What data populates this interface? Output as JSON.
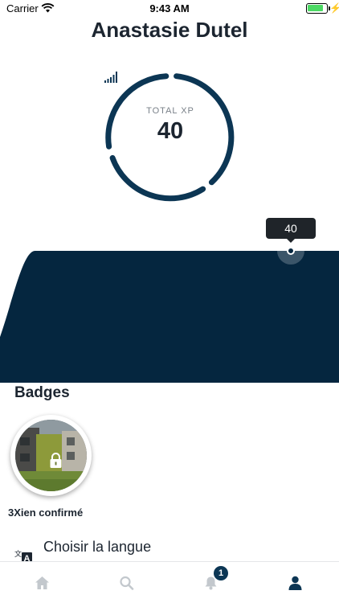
{
  "status_bar": {
    "carrier": "Carrier",
    "time": "9:43 AM",
    "battery_level": 0.85
  },
  "profile": {
    "name": "Anastasie Dutel"
  },
  "xp": {
    "label": "TOTAL XP",
    "value": "40"
  },
  "chart_data": {
    "type": "area",
    "title": "",
    "x": [
      0,
      1,
      2,
      3,
      4,
      5,
      6
    ],
    "values": [
      0,
      40,
      40,
      40,
      40,
      40,
      40
    ],
    "ylim": [
      0,
      40
    ],
    "highlight": {
      "index": 5,
      "label": "40"
    },
    "grid": false,
    "color": "#05263f"
  },
  "badges": {
    "title": "Badges",
    "items": [
      {
        "name": "3Xien confirmé",
        "locked": true
      }
    ]
  },
  "settings": {
    "language_label": "Choisir la langue",
    "icon": "translate-icon"
  },
  "tab_bar": {
    "notifications_count": "1",
    "items": [
      {
        "name": "home",
        "icon": "home-icon",
        "active": false
      },
      {
        "name": "search",
        "icon": "search-icon",
        "active": false
      },
      {
        "name": "notifications",
        "icon": "bell-icon",
        "active": false
      },
      {
        "name": "profile",
        "icon": "user-icon",
        "active": true
      }
    ]
  },
  "colors": {
    "accent": "#0c3654",
    "chart_fill": "#05263f",
    "inactive_tab": "#c3c8cd"
  }
}
